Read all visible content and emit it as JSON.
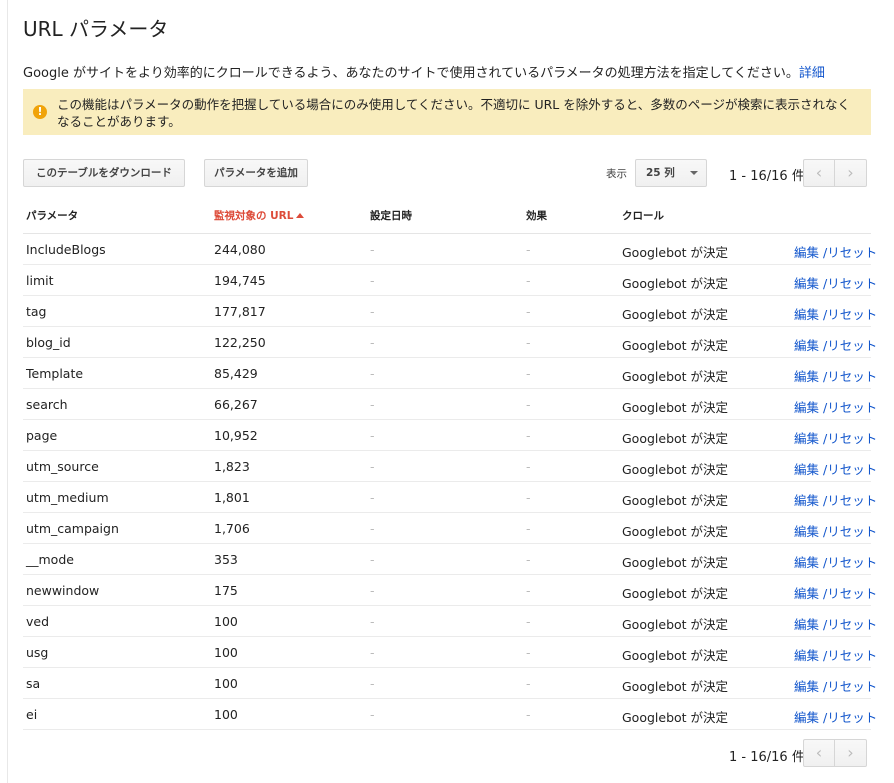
{
  "page": {
    "title": "URL パラメータ",
    "description": "Google がサイトをより効率的にクロールできるよう、あなたのサイトで使用されているパラメータの処理方法を指定してください。",
    "details_link": "詳細",
    "warning": "この機能はパラメータの動作を把握している場合にのみ使用してください。不適切に URL を除外すると、多数のページが検索に表示されなくなることがあります。"
  },
  "toolbar": {
    "download_label": "このテーブルをダウンロード",
    "add_param_label": "パラメータを追加",
    "show_label": "表示",
    "rows_value": "25 列",
    "range": "1 - 16/16 件"
  },
  "icons": {
    "warning": "warning-icon",
    "prev": "chevron-left-icon",
    "next": "chevron-right-icon"
  },
  "colors": {
    "warning_bg": "#f9edbe",
    "link": "#1155cc",
    "sorted_header": "#dd4b39"
  },
  "table": {
    "headers": {
      "param": "パラメータ",
      "urls": "監視対象の URL",
      "date": "設定日時",
      "effect": "効果",
      "crawl": "クロール"
    },
    "rows": [
      {
        "param": "IncludeBlogs",
        "urls": "244,080",
        "date": "-",
        "effect": "-",
        "crawl": "Googlebot が決定",
        "edit": "編集",
        "reset": "リセット"
      },
      {
        "param": "limit",
        "urls": "194,745",
        "date": "-",
        "effect": "-",
        "crawl": "Googlebot が決定",
        "edit": "編集",
        "reset": "リセット"
      },
      {
        "param": "tag",
        "urls": "177,817",
        "date": "-",
        "effect": "-",
        "crawl": "Googlebot が決定",
        "edit": "編集",
        "reset": "リセット"
      },
      {
        "param": "blog_id",
        "urls": "122,250",
        "date": "-",
        "effect": "-",
        "crawl": "Googlebot が決定",
        "edit": "編集",
        "reset": "リセット"
      },
      {
        "param": "Template",
        "urls": "85,429",
        "date": "-",
        "effect": "-",
        "crawl": "Googlebot が決定",
        "edit": "編集",
        "reset": "リセット"
      },
      {
        "param": "search",
        "urls": "66,267",
        "date": "-",
        "effect": "-",
        "crawl": "Googlebot が決定",
        "edit": "編集",
        "reset": "リセット"
      },
      {
        "param": "page",
        "urls": "10,952",
        "date": "-",
        "effect": "-",
        "crawl": "Googlebot が決定",
        "edit": "編集",
        "reset": "リセット"
      },
      {
        "param": "utm_source",
        "urls": "1,823",
        "date": "-",
        "effect": "-",
        "crawl": "Googlebot が決定",
        "edit": "編集",
        "reset": "リセット"
      },
      {
        "param": "utm_medium",
        "urls": "1,801",
        "date": "-",
        "effect": "-",
        "crawl": "Googlebot が決定",
        "edit": "編集",
        "reset": "リセット"
      },
      {
        "param": "utm_campaign",
        "urls": "1,706",
        "date": "-",
        "effect": "-",
        "crawl": "Googlebot が決定",
        "edit": "編集",
        "reset": "リセット"
      },
      {
        "param": "__mode",
        "urls": "353",
        "date": "-",
        "effect": "-",
        "crawl": "Googlebot が決定",
        "edit": "編集",
        "reset": "リセット"
      },
      {
        "param": "newwindow",
        "urls": "175",
        "date": "-",
        "effect": "-",
        "crawl": "Googlebot が決定",
        "edit": "編集",
        "reset": "リセット"
      },
      {
        "param": "ved",
        "urls": "100",
        "date": "-",
        "effect": "-",
        "crawl": "Googlebot が決定",
        "edit": "編集",
        "reset": "リセット"
      },
      {
        "param": "usg",
        "urls": "100",
        "date": "-",
        "effect": "-",
        "crawl": "Googlebot が決定",
        "edit": "編集",
        "reset": "リセット"
      },
      {
        "param": "sa",
        "urls": "100",
        "date": "-",
        "effect": "-",
        "crawl": "Googlebot が決定",
        "edit": "編集",
        "reset": "リセット"
      },
      {
        "param": "ei",
        "urls": "100",
        "date": "-",
        "effect": "-",
        "crawl": "Googlebot が決定",
        "edit": "編集",
        "reset": "リセット"
      }
    ]
  },
  "footer": {
    "range": "1 - 16/16 件"
  }
}
